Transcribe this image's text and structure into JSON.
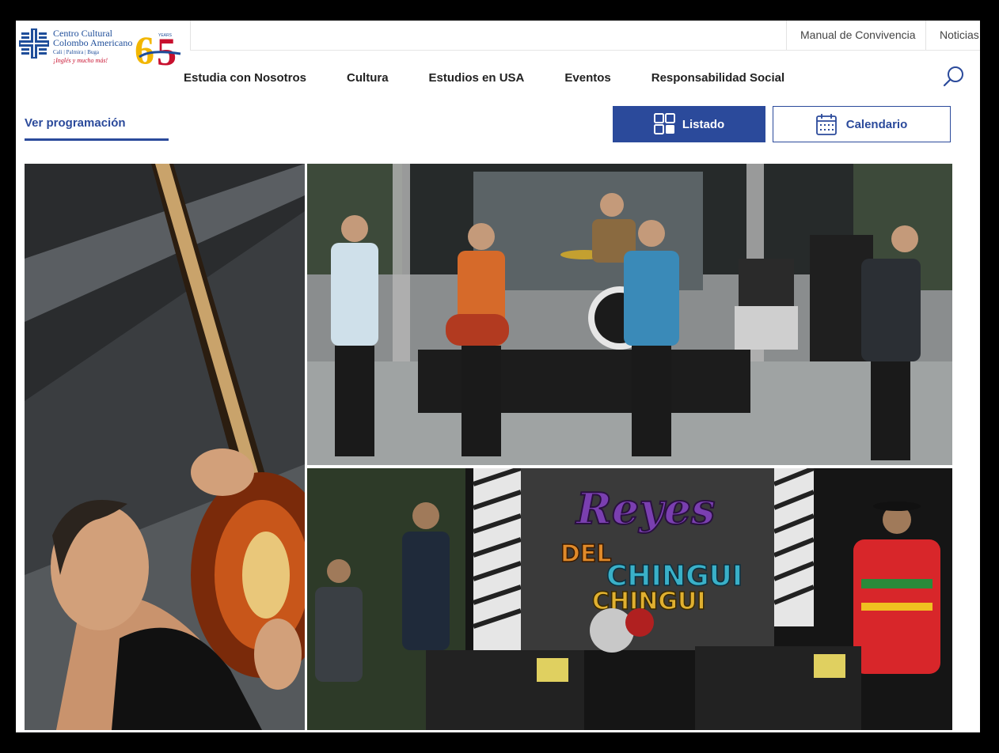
{
  "brand": {
    "org_line1": "Centro Cultural",
    "org_line2": "Colombo Americano",
    "cities": "Cali | Palmira | Buga",
    "slogan": "¡Inglés y mucho más!",
    "anniversary_number": "65",
    "anniversary_label": "YEARS",
    "colors": {
      "primary": "#2b4a9b",
      "accent_red": "#c8102e",
      "accent_yellow": "#f2b600"
    }
  },
  "top_links": [
    "Manual de Convivencia",
    "Noticias"
  ],
  "main_nav": [
    "Estudia con Nosotros",
    "Cultura",
    "Estudios en USA",
    "Eventos",
    "Responsabilidad Social"
  ],
  "search": {
    "icon": "search-icon"
  },
  "controls": {
    "ver_programacion": "Ver programación",
    "listado": "Listado",
    "listado_icon": "grid-icon",
    "calendario": "Calendario",
    "calendario_icon": "calendar-icon"
  },
  "gallery": [
    {
      "icon": "photo-guitarist-closeup"
    },
    {
      "icon": "photo-band-on-stage"
    },
    {
      "icon": "photo-reyes-del-chingui-concert",
      "banner_line1": "Reyes",
      "banner_line2": "DEL",
      "banner_line3": "CHINGUI",
      "banner_line4": "CHINGUI"
    }
  ]
}
